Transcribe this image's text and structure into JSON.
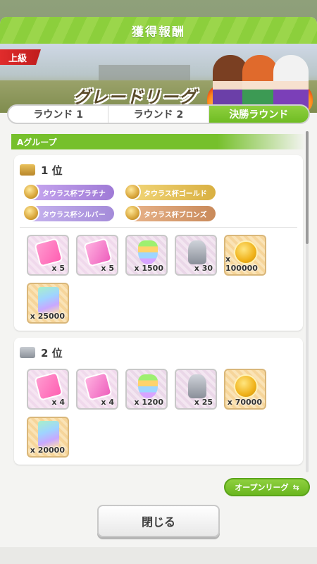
{
  "title": "獲得報酬",
  "banner": {
    "level": "上級",
    "league_name": "グレードリーグ"
  },
  "tabs": [
    {
      "label": "ラウンド 1",
      "active": false
    },
    {
      "label": "ラウンド 2",
      "active": false
    },
    {
      "label": "決勝ラウンド",
      "active": true
    }
  ],
  "group": {
    "label": "Aグループ"
  },
  "ranks": [
    {
      "title": "1 位",
      "badges": [
        "タウラス杯プラチナ",
        "タウラス杯ゴールド",
        "タウラス杯シルバー",
        "タウラス杯ブロンズ"
      ],
      "items": [
        {
          "icon": "support-ticket-icon",
          "qty": "x 5"
        },
        {
          "icon": "gacha-ticket-icon",
          "qty": "x 5"
        },
        {
          "icon": "carrot-jewel-icon",
          "qty": "x 1500"
        },
        {
          "icon": "statue-icon",
          "qty": "x 30"
        },
        {
          "icon": "coin-icon",
          "qty": "x 100000"
        },
        {
          "icon": "rainbow-card-icon",
          "qty": "x 25000"
        }
      ]
    },
    {
      "title": "2 位",
      "items": [
        {
          "icon": "support-ticket-icon",
          "qty": "x 4"
        },
        {
          "icon": "gacha-ticket-icon",
          "qty": "x 4"
        },
        {
          "icon": "carrot-jewel-icon",
          "qty": "x 1200"
        },
        {
          "icon": "statue-icon",
          "qty": "x 25"
        },
        {
          "icon": "coin-icon",
          "qty": "x 70000"
        },
        {
          "icon": "rainbow-card-icon",
          "qty": "x 20000"
        }
      ]
    }
  ],
  "buttons": {
    "open_league": "オープンリーグ",
    "close": "閉じる"
  },
  "colors": {
    "accent_green": "#76c02c",
    "level_red": "#d62424"
  }
}
